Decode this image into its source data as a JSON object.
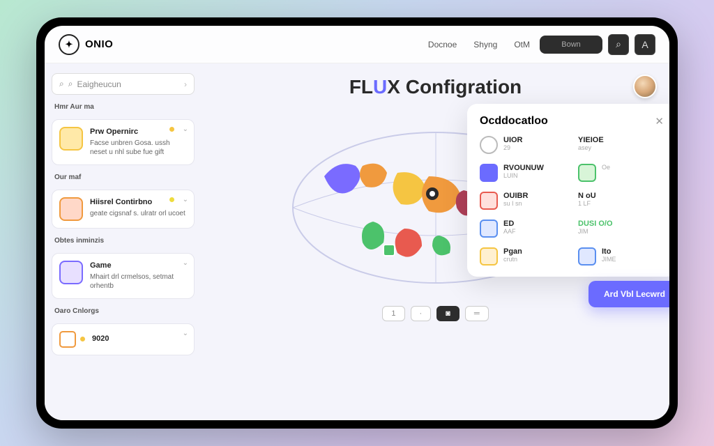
{
  "brand": "ONIO",
  "nav": {
    "item1": "Docnoe",
    "item2": "Shyng",
    "item3": "OtM"
  },
  "top": {
    "pill": "Bown",
    "searchGlyph": "⌕",
    "userGlyph": "A"
  },
  "sidebar": {
    "searchPlaceholder": "Eaigheucun",
    "heading1": "Hmr Aur ma",
    "card1": {
      "title": "Prw Opernirc",
      "desc": "Facse unbren Gosa. ussh neset u nhl sube fue gift"
    },
    "heading2": "Our maf",
    "card2": {
      "title": "Hiisrel Contirbno",
      "desc": "geate cigsnaf s. ulratr orl ucoet"
    },
    "heading3": "Obtes inminzis",
    "card3": {
      "title": "Game",
      "desc": "Mhairt drl crmelsos, setmat orhentb"
    },
    "heading4": "Oaro Cnlorgs",
    "card4": {
      "title": "9020"
    }
  },
  "page": {
    "titlePrefix": "FL",
    "titleAccent": "U",
    "titleSuffix": "X Configration"
  },
  "controls": {
    "b1": "1",
    "b2": "·",
    "b3": "◙",
    "b4": "═"
  },
  "panel": {
    "title": "Ocddocatloo",
    "rows": [
      {
        "l_label": "UIOR",
        "l_sub": "29",
        "r_label": "YIEIOE",
        "r_sub": "asey"
      },
      {
        "l_label": "RVOUNUW",
        "l_sub": "LUIN",
        "r_label": "",
        "r_sub": "Oe"
      },
      {
        "l_label": "OUIBR",
        "l_sub": "su I sn",
        "r_label": "N oU",
        "r_sub": "1 LF"
      },
      {
        "l_label": "ED",
        "l_sub": "AAF",
        "r_label": "DUSI O/O",
        "r_sub": "JIM"
      },
      {
        "l_label": "Pgan",
        "l_sub": "crutn",
        "r_label": "Ito",
        "r_sub": "JIME"
      }
    ],
    "cta": "Ard Vbl Lecwrd"
  },
  "colors": {
    "yellow": "#f5c542",
    "green": "#4cc26b",
    "purple": "#7a6bff",
    "red": "#e85a4f",
    "blue": "#5a8ff0",
    "orange": "#f09a3e",
    "teal": "#5ac2b8"
  }
}
